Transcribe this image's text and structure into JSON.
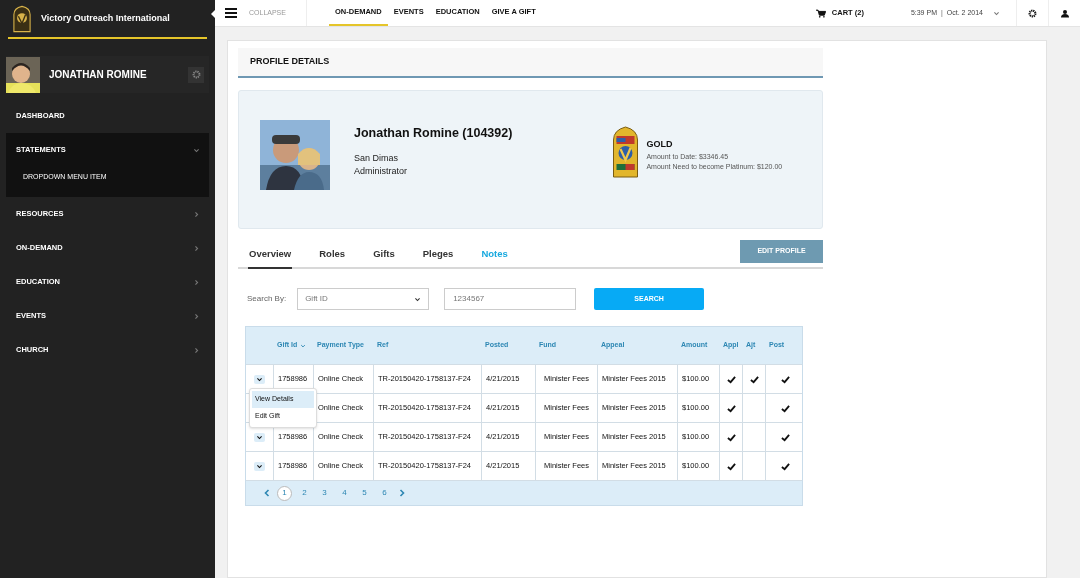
{
  "brand": {
    "name": "Victory Outreach International"
  },
  "user": {
    "name": "JONATHAN ROMINE"
  },
  "sidebar": {
    "items": [
      {
        "label": "DASHBOARD",
        "expanded": false,
        "has_arrow": false
      },
      {
        "label": "STATEMENTS",
        "expanded": true,
        "has_arrow": true,
        "children": [
          {
            "label": "DROPDOWN MENU ITEM"
          }
        ]
      },
      {
        "label": "RESOURCES",
        "expanded": false,
        "has_arrow": true
      },
      {
        "label": "ON-DEMAND",
        "expanded": false,
        "has_arrow": true
      },
      {
        "label": "EDUCATION",
        "expanded": false,
        "has_arrow": true
      },
      {
        "label": "EVENTS",
        "expanded": false,
        "has_arrow": true
      },
      {
        "label": "CHURCH",
        "expanded": false,
        "has_arrow": true
      }
    ]
  },
  "topbar": {
    "collapse": "COLLAPSE",
    "nav": [
      {
        "label": "ON-DEMAND",
        "selected": true
      },
      {
        "label": "EVENTS",
        "selected": false
      },
      {
        "label": "EDUCATION",
        "selected": false
      },
      {
        "label": "GIVE A GIFT",
        "selected": false
      }
    ],
    "cart": "CART (2)",
    "time": "5:39 PM",
    "separator": "|",
    "date": "Oct. 2 2014"
  },
  "page": {
    "title": "PROFILE DETAILS"
  },
  "profile": {
    "name": "Jonathan Romine (104392)",
    "location": "San Dimas",
    "role": "Administrator",
    "level": "GOLD",
    "amount_to_date": "Amount to Date: $3346.45",
    "amount_needed": "Amount Need to become Platinum: $120.00"
  },
  "tabs": [
    {
      "label": "Overview",
      "selected": true,
      "highlighted": false
    },
    {
      "label": "Roles",
      "selected": false,
      "highlighted": false
    },
    {
      "label": "Gifts",
      "selected": false,
      "highlighted": false
    },
    {
      "label": "Pleges",
      "selected": false,
      "highlighted": false
    },
    {
      "label": "Notes",
      "selected": false,
      "highlighted": true
    }
  ],
  "edit_button": "EDIT PROFILE",
  "search": {
    "label": "Search By:",
    "field": "Gift ID",
    "value": "1234567",
    "button": "SEARCH"
  },
  "table": {
    "columns": [
      "Gift Id",
      "Payment Type",
      "Ref",
      "Posted",
      "Fund",
      "Appeal",
      "Amount",
      "Appl",
      "Ajt",
      "Post"
    ],
    "rows": [
      {
        "gift_id": "1758986",
        "payment_type": "Online Check",
        "ref": "TR-20150420-1758137-F24",
        "posted": "4/21/2015",
        "fund": "Minister Fees",
        "appeal": "Minister Fees 2015",
        "amount": "$100.00",
        "appl": true,
        "ajt": true,
        "post": true
      },
      {
        "payment_type": "Online Check",
        "ref": "TR-20150420-1758137-F24",
        "posted": "4/21/2015",
        "fund": "Minister Fees",
        "appeal": "Minister Fees 2015",
        "amount": "$100.00",
        "appl": true,
        "ajt": false,
        "post": true
      },
      {
        "gift_id": "1758986",
        "payment_type": "Online Check",
        "ref": "TR-20150420-1758137-F24",
        "posted": "4/21/2015",
        "fund": "Minister Fees",
        "appeal": "Minister Fees 2015",
        "amount": "$100.00",
        "appl": true,
        "ajt": false,
        "post": true
      },
      {
        "gift_id": "1758986",
        "payment_type": "Online Check",
        "ref": "TR-20150420-1758137-F24",
        "posted": "4/21/2015",
        "fund": "Minister Fees",
        "appeal": "Minister Fees 2015",
        "amount": "$100.00",
        "appl": true,
        "ajt": false,
        "post": true
      }
    ],
    "row_menu": [
      {
        "label": "View Details",
        "selected": true
      },
      {
        "label": "Edit Gift",
        "selected": false
      }
    ],
    "pages": [
      {
        "label": "1",
        "selected": true
      },
      {
        "label": "2",
        "selected": false
      },
      {
        "label": "3",
        "selected": false
      },
      {
        "label": "4",
        "selected": false
      },
      {
        "label": "5",
        "selected": false
      },
      {
        "label": "6",
        "selected": false
      }
    ]
  }
}
